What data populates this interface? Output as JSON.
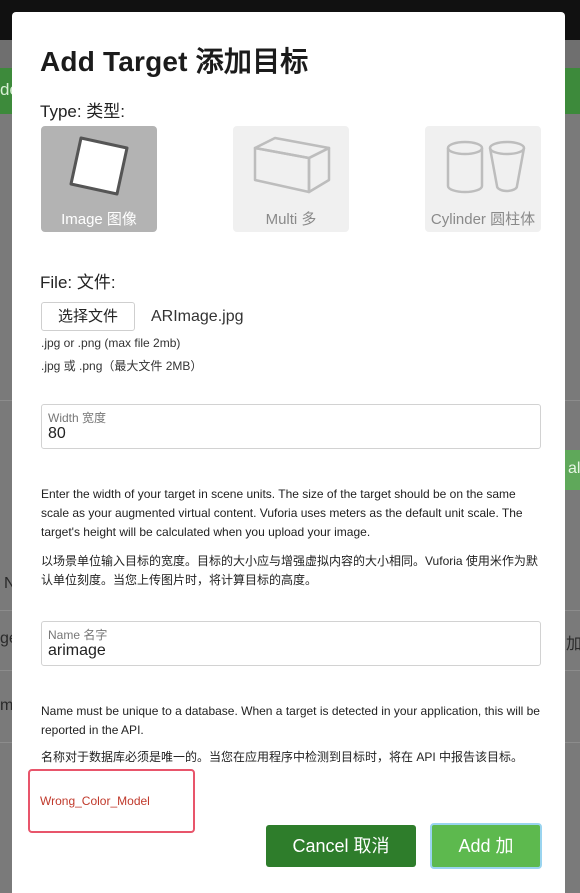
{
  "background": {
    "left_bar_text": "de",
    "right_button_text": "al",
    "rows": [
      "N",
      "ge",
      "m"
    ],
    "right_rows": [
      "加"
    ]
  },
  "modal": {
    "title": "Add Target   添加目标",
    "type_label": "Type:  类型:",
    "types": [
      {
        "label": "Image  图像",
        "icon": "image-icon",
        "selected": true
      },
      {
        "label": "Multi  多",
        "icon": "cube-icon",
        "selected": false
      },
      {
        "label": "Cylinder  圆柱体",
        "icon": "cylinder-icon",
        "selected": false
      }
    ],
    "file_label": "File:  文件:",
    "file_button": "选择文件",
    "file_name": "ARImage.jpg",
    "file_hint_en": ".jpg or .png (max file 2mb)",
    "file_hint_zh": ".jpg 或 .png（最大文件 2MB）",
    "width_field": {
      "label": "Width   宽度",
      "value": "80"
    },
    "width_help_en": "Enter the width of your target in scene units. The size of the target should be on the same scale as your augmented virtual content. Vuforia uses meters as the default unit scale. The target's height will be calculated when you upload your image.",
    "width_help_zh": "以场景单位输入目标的宽度。目标的大小应与增强虚拟内容的大小相同。Vuforia 使用米作为默认单位刻度。当您上传图片时，将计算目标的高度。",
    "name_field": {
      "label": "Name   名字",
      "value": "arimage"
    },
    "name_help_en": "Name must be unique to a database. When a target is detected in your application, this will be reported in the API.",
    "name_help_zh": "名称对于数据库必须是唯一的。当您在应用程序中检测到目标时，将在 API 中报告该目标。",
    "error_text": "Wrong_Color_Model",
    "cancel_button": "Cancel   取消",
    "add_button": "Add   加"
  },
  "colors": {
    "primary_green": "#2e7d2b",
    "add_green": "#5db94e",
    "error_red": "#c0392b",
    "highlight_border": "#e8556b"
  }
}
